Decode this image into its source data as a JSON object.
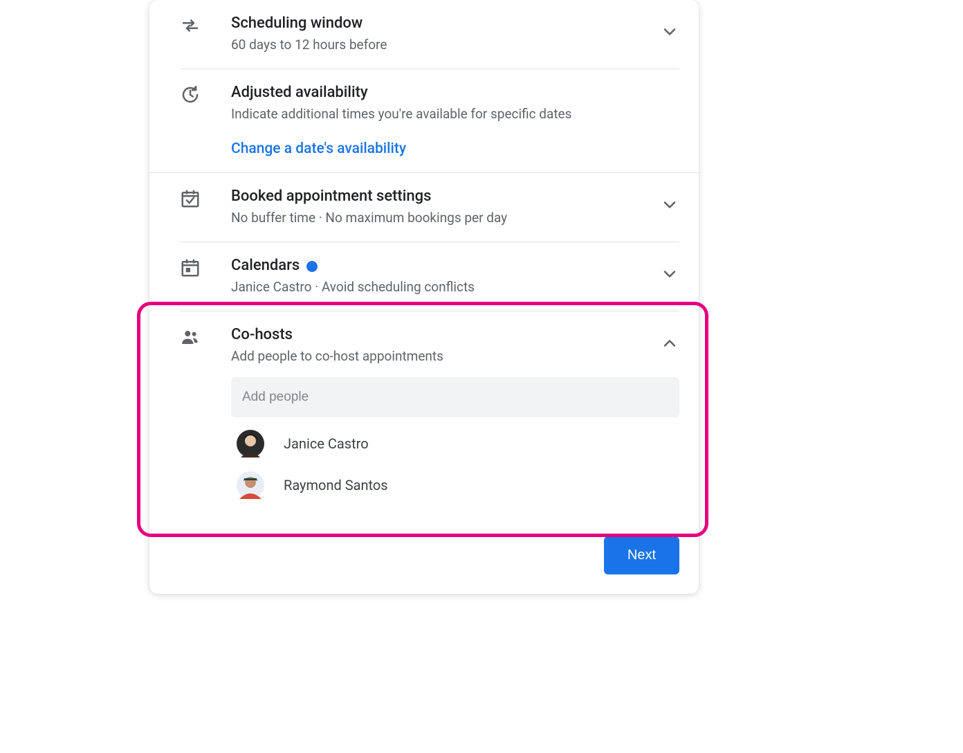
{
  "sections": {
    "scheduling": {
      "title": "Scheduling window",
      "sub": "60 days to 12 hours before"
    },
    "adjusted": {
      "title": "Adjusted availability",
      "sub": "Indicate additional times you're available for specific dates",
      "link": "Change a date's availability"
    },
    "booked": {
      "title": "Booked appointment settings",
      "sub": "No buffer time · No maximum bookings per day"
    },
    "calendars": {
      "title": "Calendars",
      "sub": "Janice Castro · Avoid scheduling conflicts"
    },
    "cohosts": {
      "title": "Co-hosts",
      "sub": "Add people to co-host appointments",
      "placeholder": "Add people",
      "people": [
        {
          "name": "Janice Castro"
        },
        {
          "name": "Raymond Santos"
        }
      ]
    }
  },
  "footer": {
    "next": "Next"
  }
}
